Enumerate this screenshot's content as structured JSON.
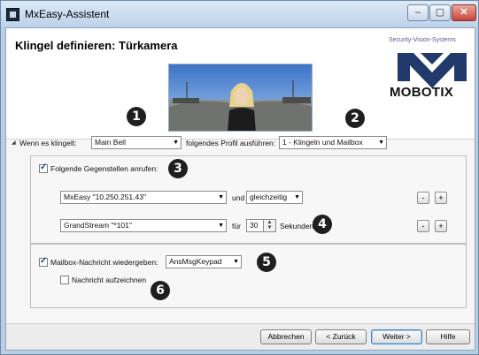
{
  "window": {
    "title": "MxEasy-Assistent",
    "controls": {
      "minimize": "–",
      "maximize": "▢",
      "close": "✕"
    }
  },
  "header": {
    "title": "Klingel definieren: Türkamera",
    "tagline": "Security-Vision-Systems",
    "logo_text": "MOBOTIX"
  },
  "badges": [
    "1",
    "2",
    "3",
    "4",
    "5",
    "6"
  ],
  "ring_row": {
    "toggle": "◢",
    "when_label": "Wenn es klingelt:",
    "bell_value": "Main Bell",
    "profile_label": "folgendes Profil ausführen:",
    "profile_value": "1 - Klingeln und Mailbox"
  },
  "call_group": {
    "checkbox_label": "Folgende Gegenstellen anrufen:",
    "checked": true,
    "row1": {
      "station": "MxEasy \"10.250.251.43\"",
      "conj": "und",
      "mode": "gleichzeitig",
      "remove": "-",
      "add": "+"
    },
    "row2": {
      "station": "GrandStream \"*101\"",
      "conj": "für",
      "seconds": "30",
      "unit": "Sekunden",
      "remove": "-",
      "add": "+"
    }
  },
  "mailbox_group": {
    "play_label": "Mailbox-Nachricht wiedergeben:",
    "play_checked": true,
    "message_value": "AnsMsgKeypad",
    "record_label": "Nachricht aufzeichnen",
    "record_checked": false
  },
  "footer": {
    "cancel": "Abbrechen",
    "back": "< Zurück",
    "next": "Weiter >",
    "help": "Hilfe"
  },
  "colors": {
    "badge": "#1f1f1f",
    "window_frame": "#b9cde3",
    "checkmark": "#1c3f9c"
  }
}
